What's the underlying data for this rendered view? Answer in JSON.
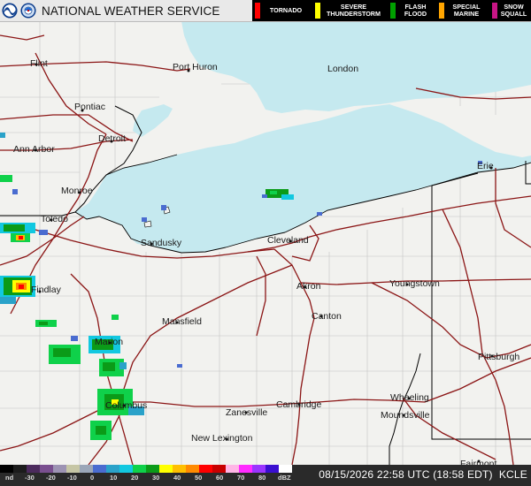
{
  "header": {
    "title": "NATIONAL WEATHER SERVICE",
    "noaa_logo_icon": "noaa-logo-icon",
    "nws_logo_icon": "nws-logo-icon"
  },
  "warnings_legend": [
    {
      "label_line1": "TORNADO",
      "label_line2": "",
      "color": "#ff0000"
    },
    {
      "label_line1": "SEVERE",
      "label_line2": "THUNDERSTORM",
      "color": "#ffff00"
    },
    {
      "label_line1": "FLASH",
      "label_line2": "FLOOD",
      "color": "#00a000"
    },
    {
      "label_line1": "SPECIAL",
      "label_line2": "MARINE",
      "color": "#ffa500"
    },
    {
      "label_line1": "SNOW",
      "label_line2": "SQUALL",
      "color": "#c71585"
    }
  ],
  "map": {
    "lake_name": "Lake Erie",
    "water_color": "#c5e9ef",
    "land_color": "#f2f2ef",
    "highway_color": "#8b1515",
    "boundary_color": "#000000"
  },
  "cities": [
    {
      "name": "Flint"
    },
    {
      "name": "Port Huron"
    },
    {
      "name": "London"
    },
    {
      "name": "Pontiac"
    },
    {
      "name": "Detroit"
    },
    {
      "name": "Ann Arbor"
    },
    {
      "name": "Monroe"
    },
    {
      "name": "Toledo"
    },
    {
      "name": "Sandusky"
    },
    {
      "name": "Erie"
    },
    {
      "name": "Cleveland"
    },
    {
      "name": "Findlay"
    },
    {
      "name": "Akron"
    },
    {
      "name": "Youngstown"
    },
    {
      "name": "Mansfield"
    },
    {
      "name": "Canton"
    },
    {
      "name": "Marion"
    },
    {
      "name": "Pittsburgh"
    },
    {
      "name": "Wheeling"
    },
    {
      "name": "Columbus"
    },
    {
      "name": "Zanesville"
    },
    {
      "name": "Cambridge"
    },
    {
      "name": "Moundsville"
    },
    {
      "name": "New Lexington"
    },
    {
      "name": "Fairmont"
    }
  ],
  "reflectivity_scale": {
    "labels": [
      "nd",
      "-30",
      "-20",
      "-10",
      "0",
      "10",
      "20",
      "30",
      "40",
      "50",
      "60",
      "70",
      "80",
      "dBZ"
    ],
    "colors": [
      "#000000",
      "#1c1c1c",
      "#4b2a5c",
      "#7a4f8f",
      "#9d93b3",
      "#c6c6a5",
      "#9aa6b8",
      "#4a6cd0",
      "#2aa2c9",
      "#12c8e0",
      "#0fd14a",
      "#0b9b18",
      "#ffff00",
      "#ffbf00",
      "#ff8a00",
      "#ff0000",
      "#c80000",
      "#ffb6e6",
      "#ff2bff",
      "#9a34ff",
      "#3a0fd0",
      "#ffffff"
    ]
  },
  "timestamp": "08/15/2026 22:58 UTC (18:58 EDT)",
  "station": "KCLE"
}
